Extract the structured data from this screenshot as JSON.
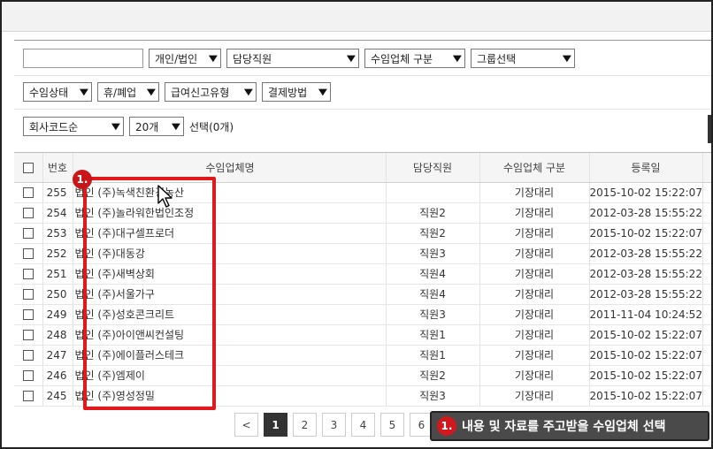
{
  "filters": {
    "search_placeholder": "",
    "entity_type": "개인/법인",
    "staff": "담당직원",
    "client_type": "수임업체 구분",
    "group": "그룹선택",
    "status": "수임상태",
    "closure": "휴/폐업",
    "report_type": "급여신고유형",
    "payment": "결제방법",
    "sort": "회사코드순",
    "page_size": "20개",
    "selection_info": "선택(0개)"
  },
  "table": {
    "headers": {
      "no": "번호",
      "name": "수임업체명",
      "staff": "담당직원",
      "type": "수임업체 구분",
      "date": "등록일"
    },
    "rows": [
      {
        "no": "255",
        "name": "법인 (주)녹색친환경농산",
        "staff": "",
        "type": "기장대리",
        "date": "2015-10-02 15:22:07"
      },
      {
        "no": "254",
        "name": "법인 (주)놀라워한법인조정",
        "staff": "직원2",
        "type": "기장대리",
        "date": "2012-03-28 15:55:22"
      },
      {
        "no": "253",
        "name": "법인 (주)대구셀프로더",
        "staff": "직원2",
        "type": "기장대리",
        "date": "2015-10-02 15:22:07"
      },
      {
        "no": "252",
        "name": "법인 (주)대동강",
        "staff": "직원3",
        "type": "기장대리",
        "date": "2012-03-28 15:55:22"
      },
      {
        "no": "251",
        "name": "법인 (주)새벽상회",
        "staff": "직원4",
        "type": "기장대리",
        "date": "2012-03-28 15:55:22"
      },
      {
        "no": "250",
        "name": "법인 (주)서울가구",
        "staff": "직원4",
        "type": "기장대리",
        "date": "2012-03-28 15:55:22"
      },
      {
        "no": "249",
        "name": "법인 (주)성호콘크리트",
        "staff": "직원3",
        "type": "기장대리",
        "date": "2011-11-04 10:24:52"
      },
      {
        "no": "248",
        "name": "법인 (주)아이앤씨컨설팅",
        "staff": "직원1",
        "type": "기장대리",
        "date": "2015-10-02 15:22:07"
      },
      {
        "no": "247",
        "name": "법인 (주)에이플러스테크",
        "staff": "직원1",
        "type": "기장대리",
        "date": "2015-10-02 15:22:07"
      },
      {
        "no": "246",
        "name": "법인 (주)엠제이",
        "staff": "직원2",
        "type": "기장대리",
        "date": "2015-10-02 15:22:07"
      },
      {
        "no": "245",
        "name": "법인 (주)영성정밀",
        "staff": "직원3",
        "type": "기장대리",
        "date": "2015-10-02 15:22:07"
      }
    ]
  },
  "pagination": {
    "prev": "<",
    "pages": [
      "1",
      "2",
      "3",
      "4",
      "5",
      "6"
    ]
  },
  "annotation": {
    "badge": "1.",
    "callout_badge": "1.",
    "callout_text": "내용 및 자료를 주고받을 수임업체 선택"
  },
  "colors": {
    "highlight": "#e0191b",
    "callout_bg": "#4a4a4a"
  }
}
